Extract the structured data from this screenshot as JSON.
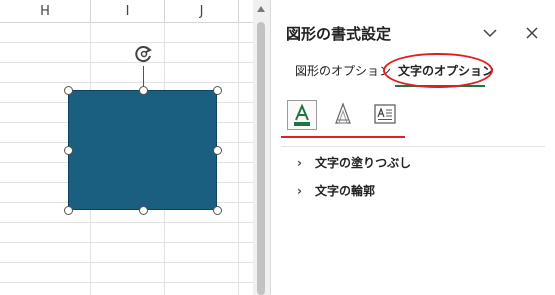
{
  "sheet": {
    "columns": [
      "H",
      "I",
      "J"
    ]
  },
  "panel": {
    "title": "図形の書式設定",
    "tabs": [
      {
        "label": "図形のオプション"
      },
      {
        "label": "文字のオプション"
      }
    ],
    "icons": [
      "text-fill-outline-icon",
      "text-effects-icon",
      "textbox-icon"
    ],
    "sections": [
      {
        "label": "文字の塗りつぶし"
      },
      {
        "label": "文字の輪郭"
      }
    ]
  },
  "colors": {
    "shape_fill": "#1a5e80",
    "accent_green": "#217346",
    "annotation_red": "#e02020"
  }
}
